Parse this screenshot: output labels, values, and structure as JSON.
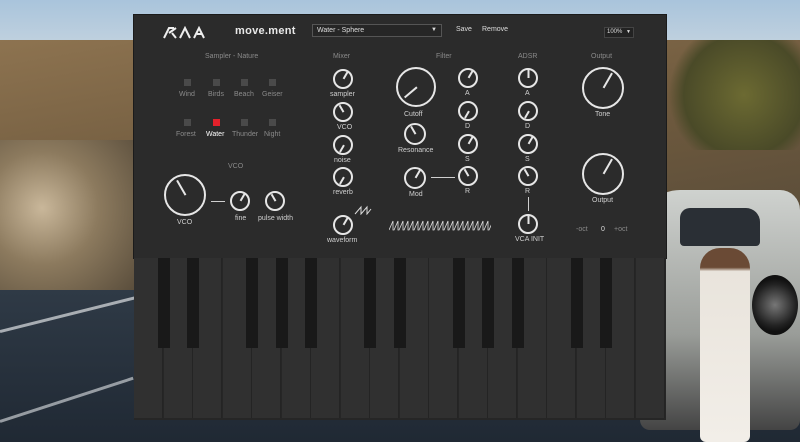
{
  "colors": {
    "panel": "#2b2b2b",
    "accent": "#e3212b",
    "text": "#cfcfcf",
    "keyboard": "#303030"
  },
  "header": {
    "logo_text": "KIA",
    "brand": "move.ment",
    "preset": "Water - Sphere",
    "save_label": "Save",
    "remove_label": "Remove",
    "zoom": "100%"
  },
  "sampler": {
    "title": "Sampler - Nature",
    "items": [
      "Wind",
      "Birds",
      "Beach",
      "Geiser",
      "Forest",
      "Water",
      "Thunder",
      "Night"
    ],
    "active": "Water"
  },
  "vco": {
    "title": "VCO",
    "main_label": "VCO",
    "fine_label": "fine",
    "pulse_label": "pulse width"
  },
  "mixer": {
    "title": "Mixer",
    "labels": [
      "sampler",
      "VCO",
      "noise",
      "reverb",
      "waveform"
    ]
  },
  "filter": {
    "title": "Filter",
    "cutoff_label": "Cutoff",
    "resonance_label": "Resonance",
    "mod_label": "Mod",
    "env_labels": [
      "A",
      "D",
      "S",
      "R"
    ]
  },
  "adsr": {
    "title": "ADSR",
    "labels": [
      "A",
      "D",
      "S",
      "R"
    ],
    "vca_label": "VCA INIT"
  },
  "output": {
    "title": "Output",
    "tone_label": "Tone",
    "output_label": "Output",
    "minus_oct": "-oct",
    "plus_oct": "+oct",
    "octave_value": "0"
  }
}
